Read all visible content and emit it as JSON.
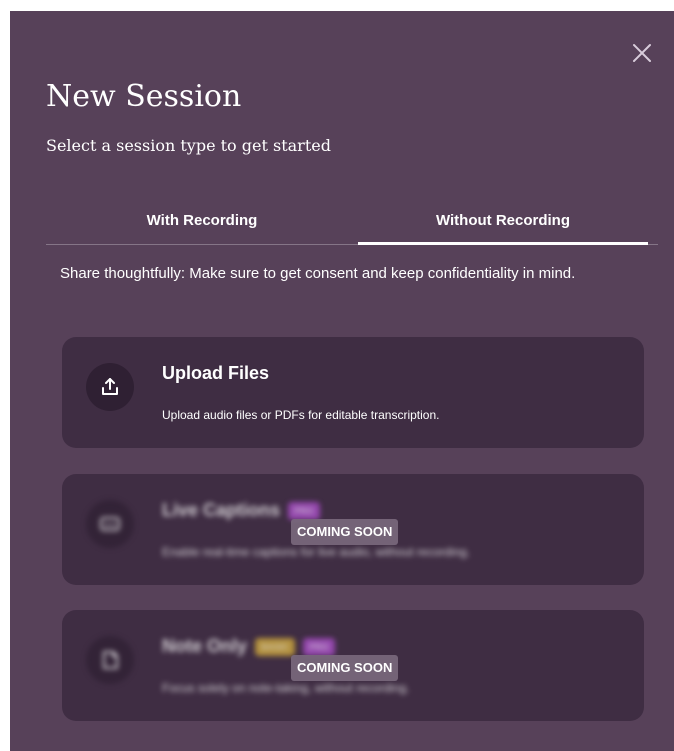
{
  "dialog": {
    "title": "New Session",
    "subtitle": "Select a session type to get started"
  },
  "tabs": [
    {
      "label": "With Recording",
      "selected": false
    },
    {
      "label": "Without Recording",
      "selected": true
    }
  ],
  "notice": "Share thoughtfully: Make sure to get consent and keep confidentiality in mind.",
  "options": [
    {
      "title": "Upload Files",
      "description": "Upload audio files or PDFs for editable transcription.",
      "icon": "upload-icon",
      "available": true
    },
    {
      "title": "Live Captions",
      "description": "Enable real-time captions for live audio, without recording.",
      "icon": "captions-icon",
      "available": false,
      "badges": [
        "PRO"
      ],
      "status": "COMING SOON"
    },
    {
      "title": "Note Only",
      "description": "Focus solely on note-taking, without recording.",
      "icon": "note-icon",
      "available": false,
      "badges": [
        "BASIC",
        "PRO"
      ],
      "status": "COMING SOON"
    }
  ],
  "colors": {
    "modal_background": "#574159",
    "card_background": "#3f2d43",
    "badge_pro": "#b04fd0",
    "badge_basic": "#d9b13a",
    "text": "#ffffff"
  }
}
